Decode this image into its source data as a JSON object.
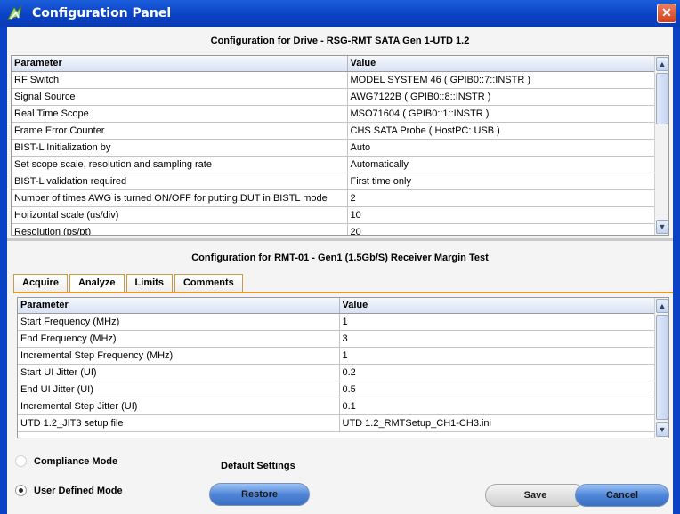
{
  "window": {
    "title": "Configuration Panel",
    "close_glyph": "✕"
  },
  "drive": {
    "title": "Configuration for Drive - RSG-RMT SATA Gen 1-UTD 1.2",
    "headers": [
      "Parameter",
      "Value"
    ],
    "rows": [
      [
        "RF Switch",
        "MODEL SYSTEM 46 ( GPIB0::7::INSTR )"
      ],
      [
        "Signal Source",
        "AWG7122B ( GPIB0::8::INSTR )"
      ],
      [
        "Real Time Scope",
        "MSO71604 ( GPIB0::1::INSTR )"
      ],
      [
        "Frame Error Counter",
        "CHS SATA Probe ( HostPC: USB )"
      ],
      [
        "BIST-L Initialization by",
        "Auto"
      ],
      [
        "Set scope scale, resolution and sampling rate",
        "Automatically"
      ],
      [
        "BIST-L validation required",
        "First time only"
      ],
      [
        "Number of times AWG is turned ON/OFF for putting DUT in BISTL mode",
        "2"
      ],
      [
        "Horizontal scale (us/div)",
        "10"
      ],
      [
        "Resolution (ps/pt)",
        "20"
      ]
    ]
  },
  "test": {
    "title": "Configuration for RMT-01 - Gen1 (1.5Gb/S) Receiver Margin Test",
    "tabs": [
      "Acquire",
      "Analyze",
      "Limits",
      "Comments"
    ],
    "active_tab": "Analyze",
    "headers": [
      "Parameter",
      "Value"
    ],
    "rows": [
      [
        "Start Frequency (MHz)",
        "1"
      ],
      [
        "End Frequency (MHz)",
        "3"
      ],
      [
        "Incremental Step Frequency (MHz)",
        "1"
      ],
      [
        "Start UI Jitter (UI)",
        "0.2"
      ],
      [
        "End UI Jitter (UI)",
        "0.5"
      ],
      [
        "Incremental Step Jitter (UI)",
        "0.1"
      ],
      [
        "UTD 1.2_JIT3 setup file",
        "UTD 1.2_RMTSetup_CH1-CH3.ini"
      ]
    ]
  },
  "footer": {
    "compliance_mode": "Compliance Mode",
    "user_defined_mode": "User Defined Mode",
    "default_settings": "Default Settings",
    "restore": "Restore",
    "save": "Save",
    "cancel": "Cancel"
  },
  "colors": {
    "title_bar": "#0a42c6",
    "tab_accent": "#e39a2b",
    "button_blue": "#4f86d8"
  }
}
